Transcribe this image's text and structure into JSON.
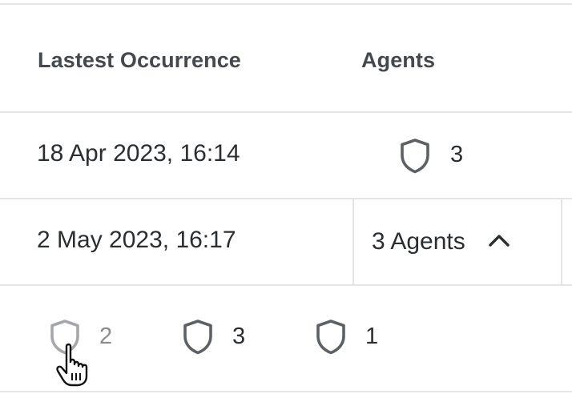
{
  "table": {
    "headers": {
      "latest_occurrence": "Lastest Occurrence",
      "agents": "Agents"
    },
    "rows": [
      {
        "latest_occurrence": "18 Apr 2023, 16:14",
        "agents_count": "3",
        "agent_icon": "shield-icon"
      },
      {
        "latest_occurrence": "2 May 2023, 16:17",
        "agents_toggle_label": "3 Agents",
        "toggle_icon": "chevron-up-icon",
        "expanded": true
      }
    ],
    "expanded_agents": [
      {
        "icon": "shield-icon",
        "count": "2",
        "hovered": true
      },
      {
        "icon": "shield-icon",
        "count": "3",
        "hovered": false
      },
      {
        "icon": "shield-icon",
        "count": "1",
        "hovered": false
      }
    ]
  },
  "cursor": {
    "type": "hand-pointer"
  }
}
